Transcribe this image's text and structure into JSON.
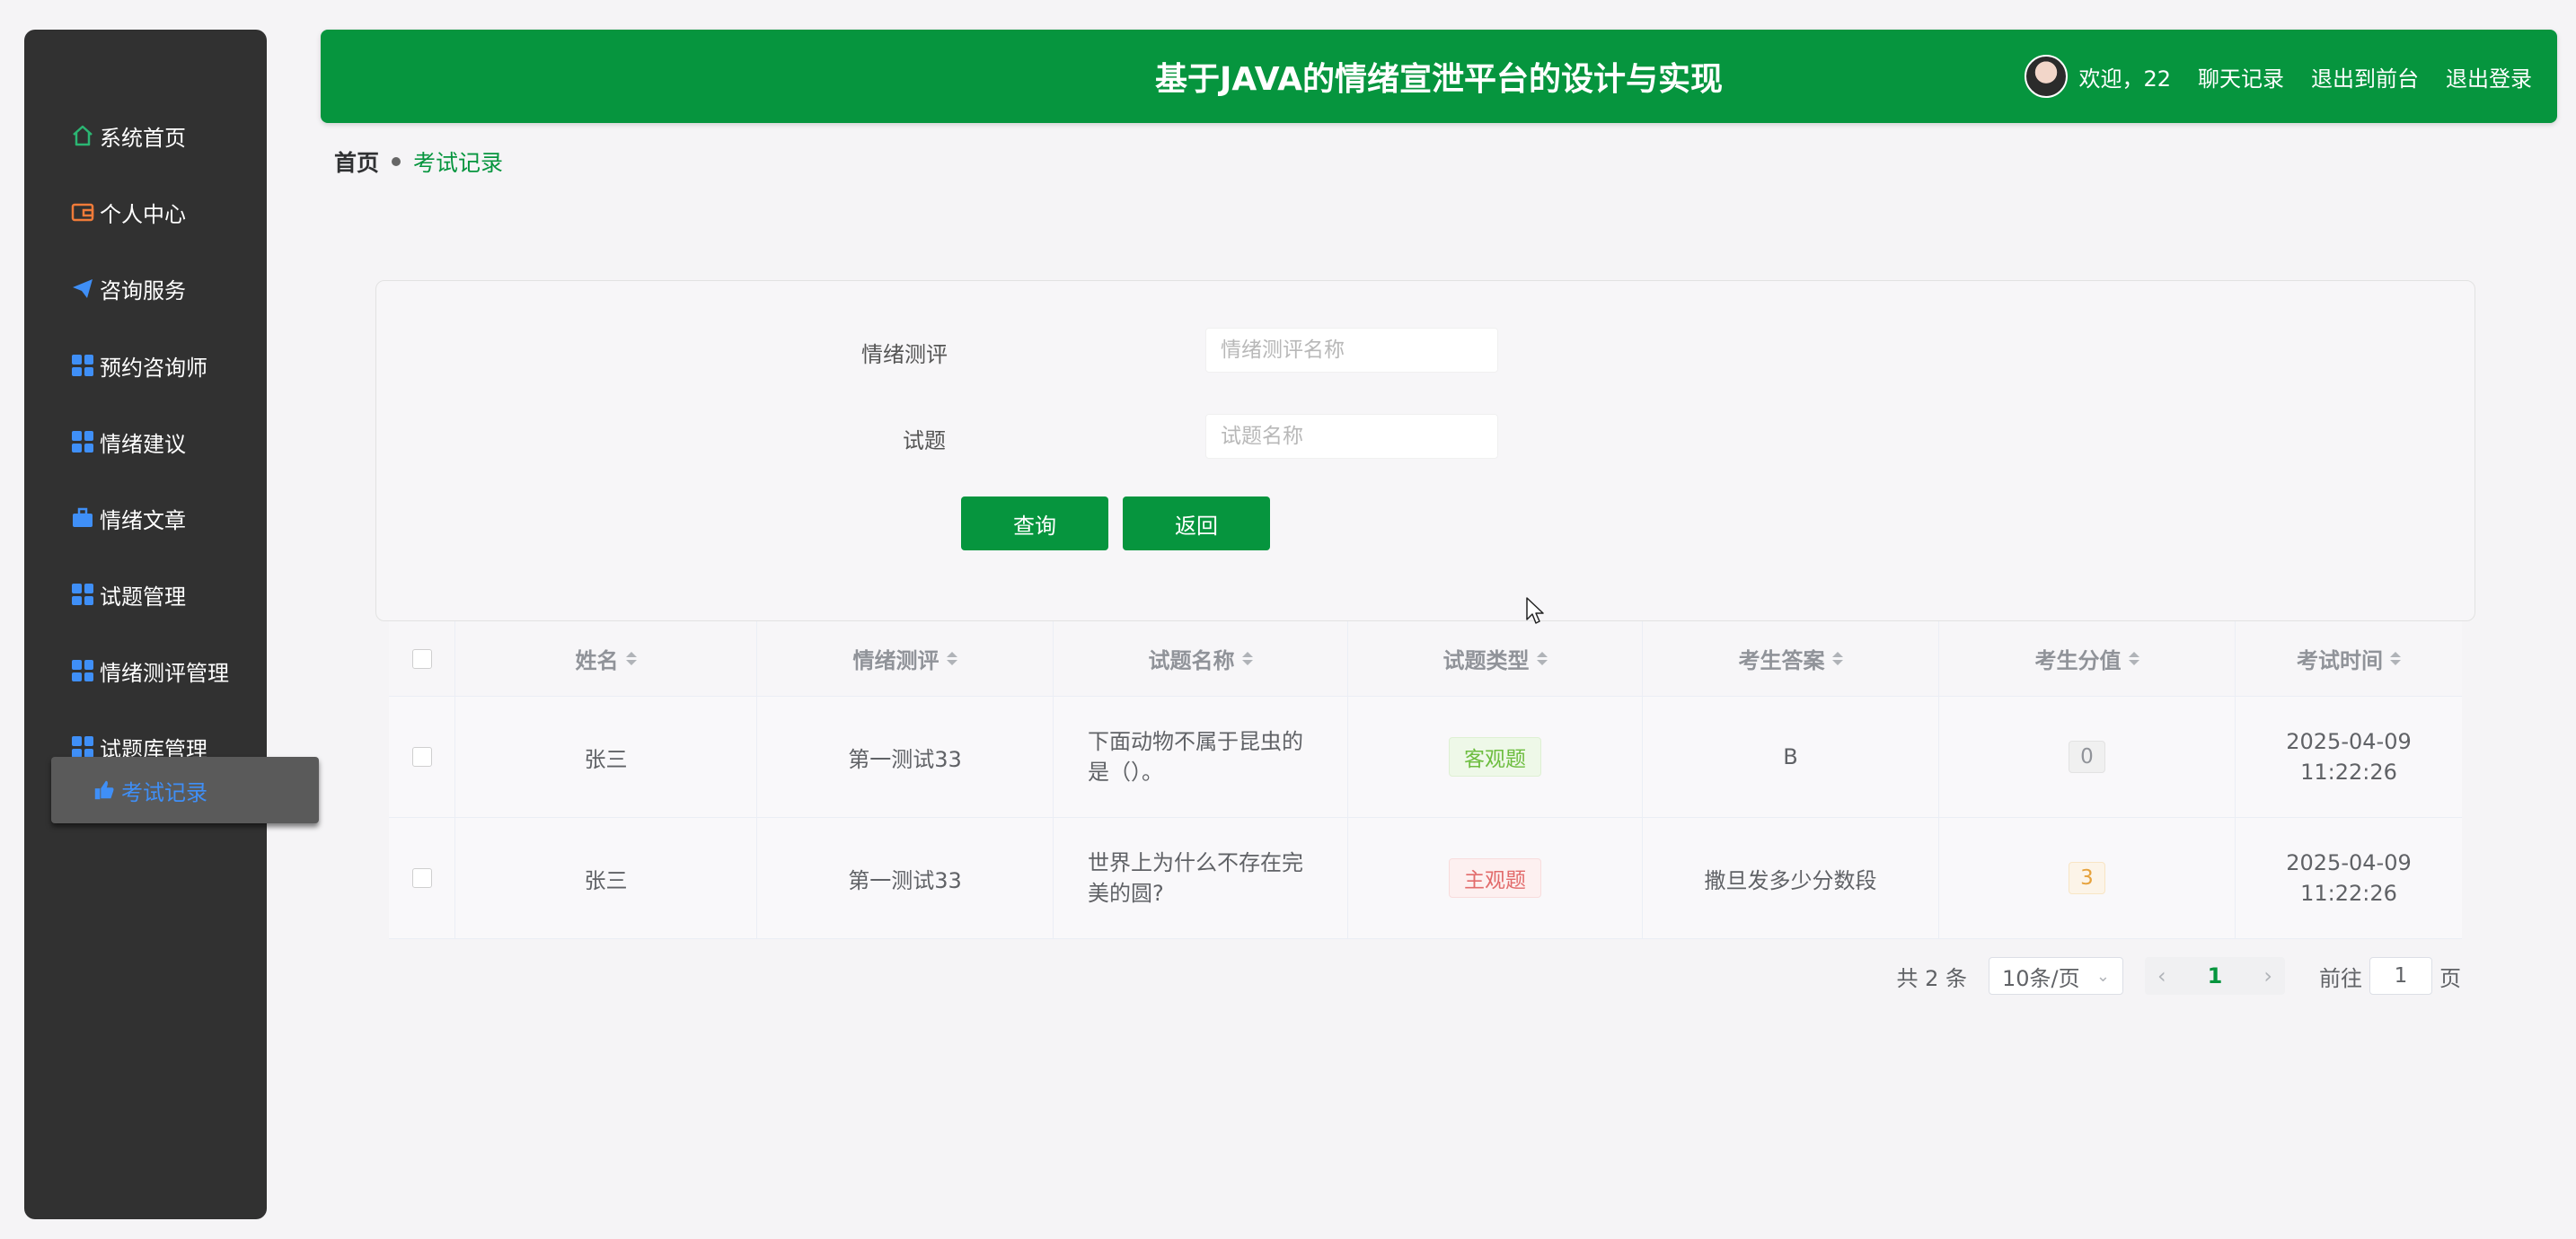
{
  "sidebar": {
    "items": [
      {
        "label": "系统首页",
        "icon": "home-icon"
      },
      {
        "label": "个人中心",
        "icon": "wallet-icon"
      },
      {
        "label": "咨询服务",
        "icon": "paper-plane-icon"
      },
      {
        "label": "预约咨询师",
        "icon": "grid-icon"
      },
      {
        "label": "情绪建议",
        "icon": "grid-icon"
      },
      {
        "label": "情绪文章",
        "icon": "briefcase-icon"
      },
      {
        "label": "试题管理",
        "icon": "grid-icon"
      },
      {
        "label": "情绪测评管理",
        "icon": "grid-icon"
      },
      {
        "label": "试题库管理",
        "icon": "grid-icon"
      }
    ],
    "active": {
      "label": "考试记录",
      "icon": "thumbs-up-icon"
    },
    "colors": {
      "background": "#313131",
      "icon_accent": "#3f8ff7"
    }
  },
  "header": {
    "title": "基于JAVA的情绪宣泄平台的设计与实现",
    "welcome": "欢迎，22",
    "links": [
      "聊天记录",
      "退出到前台",
      "退出登录"
    ],
    "color": "#06953e"
  },
  "breadcrumb": {
    "home": "首页",
    "current": "考试记录"
  },
  "search": {
    "field1_label": "情绪测评",
    "field1_placeholder": "情绪测评名称",
    "field2_label": "试题",
    "field2_placeholder": "试题名称",
    "query_button": "查询",
    "back_button": "返回"
  },
  "table": {
    "columns": [
      "姓名",
      "情绪测评",
      "试题名称",
      "试题类型",
      "考生答案",
      "考生分值",
      "考试时间"
    ],
    "rows": [
      {
        "name": "张三",
        "assessment": "第一测试33",
        "question": "下面动物不属于昆虫的是（）。",
        "type": "客观题",
        "answer": "B",
        "score": "0",
        "time": "2025-04-09 11:22:26"
      },
      {
        "name": "张三",
        "assessment": "第一测试33",
        "question": "世界上为什么不存在完美的圆?",
        "type": "主观题",
        "answer": "撒旦发多少分数段",
        "score": "3",
        "time": "2025-04-09 11:22:26"
      }
    ]
  },
  "pagination": {
    "total": "共 2 条",
    "page_size": "10条/页",
    "current_page": "1",
    "goto_label": "前往",
    "goto_value": "1",
    "page_suffix": "页"
  }
}
